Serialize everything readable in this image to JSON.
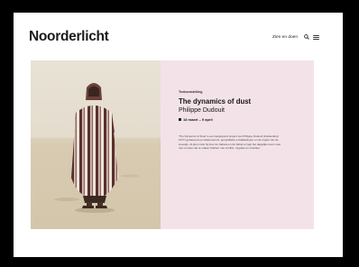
{
  "header": {
    "logo_text": "Noorderlicht",
    "cta_label": "Zien en doen",
    "search_icon": "search-icon",
    "menu_icon": "hamburger-menu-icon"
  },
  "feature": {
    "kicker": "Tentoonstelling",
    "title": "The dynamics of dust",
    "artist": "Philippe Dudouit",
    "dates": "18 maart – 9 april",
    "description": "'The Dynamics of Dust' is een langlopend project van Philippe Dudouit (Zwitserland, 1977) gebaseerd op lokale kennis, geopolitieke ontwikkelingen en de regels van de woestijn. Al jaren reist hij door de Sahara en de Sahel en legt het dagelijks leven vast van mensen die te maken hebben met conflict, migratie en smokkel.",
    "image_alt": "Man in gestreepte djellaba in de woestijn",
    "panel_color": "#f3e3e8"
  }
}
